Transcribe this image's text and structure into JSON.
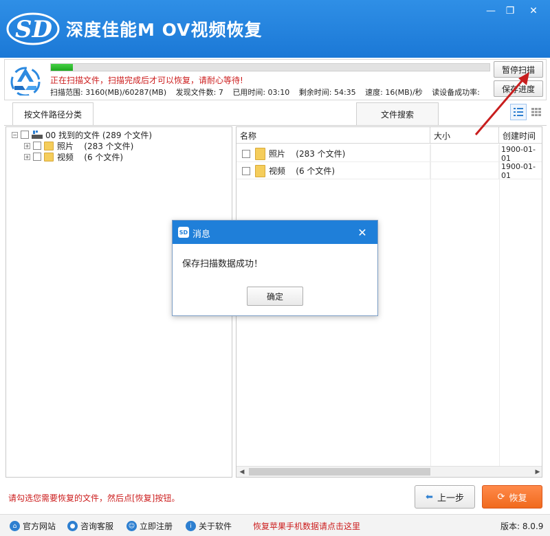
{
  "app": {
    "logo_text": "SD",
    "title": "深度佳能M OV视频恢复",
    "window_controls": {
      "minimize": "—",
      "maximize": "❐",
      "close": "✕"
    }
  },
  "scan": {
    "progress": 0.05,
    "status": "正在扫描文件，扫描完成后才可以恢复，请耐心等待!",
    "range": "扫描范围: 3160(MB)/60287(MB)",
    "found": "发现文件数: 7",
    "elapsed": "已用时间: 03:10",
    "remaining": "剩余时间: 54:35",
    "speed": "速度: 16(MB)/秒",
    "read_rate": "读设备成功率:",
    "pause_label": "暂停扫描",
    "save_progress_label": "保存进度"
  },
  "tabs": {
    "by_path": "按文件路径分类",
    "search": "文件搜索"
  },
  "tree": {
    "root": {
      "label": "00 找到的文件",
      "count": "(289 个文件)"
    },
    "children": [
      {
        "label": "照片",
        "count": "(283 个文件)"
      },
      {
        "label": "视频",
        "count": "(6 个文件)"
      }
    ]
  },
  "file_list": {
    "columns": [
      "名称",
      "大小",
      "创建时间"
    ],
    "rows": [
      {
        "name": "照片",
        "count": "(283 个文件)",
        "size": "",
        "created": "1900-01-01"
      },
      {
        "name": "视频",
        "count": "(6 个文件)",
        "size": "",
        "created": "1900-01-01"
      }
    ]
  },
  "dialog": {
    "title": "消息",
    "message": "保存扫描数据成功！",
    "ok": "确定",
    "close": "✕"
  },
  "bottom": {
    "hint": "请勾选您需要恢复的文件，然后点[恢复]按钮。",
    "prev": "上一步",
    "recover": "恢复"
  },
  "statusbar": {
    "website": "官方网站",
    "support": "咨询客服",
    "register": "立即注册",
    "about": "关于软件",
    "apple_hint": "恢复苹果手机数据请点击这里",
    "version": "版本: 8.0.9"
  },
  "colors": {
    "title_bar": "#1b78d6",
    "accent_red": "#cc1d1d",
    "recover_orange": "#f06a1d",
    "progress_green": "#1ea81e"
  }
}
